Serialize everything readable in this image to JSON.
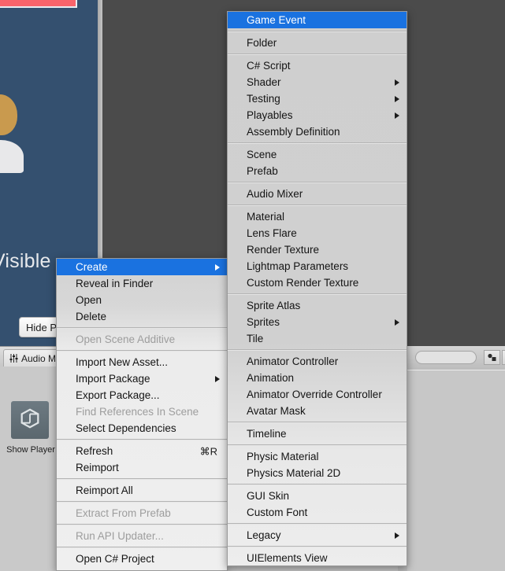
{
  "editor": {
    "game_view": {
      "overlay_text": "Visible",
      "hide_button_label": "Hide P"
    },
    "tab_label": "Audio Mix",
    "tab_icon": "audio-mixer-icon",
    "asset": {
      "icon": "unity-logo-icon",
      "label": "Show Player"
    },
    "search_placeholder": "",
    "toolbar_icons": [
      "asset-filter-icon",
      "favorites-icon"
    ]
  },
  "asset_menu": {
    "name": "assets-context-menu",
    "groups": [
      {
        "items": [
          {
            "label": "Create",
            "submenu": true,
            "selected": true,
            "disabled": false
          },
          {
            "label": "Reveal in Finder",
            "submenu": false,
            "selected": false,
            "disabled": false
          },
          {
            "label": "Open",
            "submenu": false,
            "selected": false,
            "disabled": false
          },
          {
            "label": "Delete",
            "submenu": false,
            "selected": false,
            "disabled": false
          }
        ]
      },
      {
        "items": [
          {
            "label": "Open Scene Additive",
            "submenu": false,
            "selected": false,
            "disabled": true
          }
        ]
      },
      {
        "items": [
          {
            "label": "Import New Asset...",
            "submenu": false,
            "selected": false,
            "disabled": false
          },
          {
            "label": "Import Package",
            "submenu": true,
            "selected": false,
            "disabled": false
          },
          {
            "label": "Export Package...",
            "submenu": false,
            "selected": false,
            "disabled": false
          },
          {
            "label": "Find References In Scene",
            "submenu": false,
            "selected": false,
            "disabled": true
          },
          {
            "label": "Select Dependencies",
            "submenu": false,
            "selected": false,
            "disabled": false
          }
        ]
      },
      {
        "items": [
          {
            "label": "Refresh",
            "shortcut": "⌘R",
            "submenu": false,
            "selected": false,
            "disabled": false
          },
          {
            "label": "Reimport",
            "submenu": false,
            "selected": false,
            "disabled": false
          }
        ]
      },
      {
        "items": [
          {
            "label": "Reimport All",
            "submenu": false,
            "selected": false,
            "disabled": false
          }
        ]
      },
      {
        "items": [
          {
            "label": "Extract From Prefab",
            "submenu": false,
            "selected": false,
            "disabled": true
          }
        ]
      },
      {
        "items": [
          {
            "label": "Run API Updater...",
            "submenu": false,
            "selected": false,
            "disabled": true
          }
        ]
      },
      {
        "items": [
          {
            "label": "Open C# Project",
            "submenu": false,
            "selected": false,
            "disabled": false
          }
        ]
      }
    ]
  },
  "create_menu": {
    "name": "create-submenu",
    "groups": [
      {
        "items": [
          {
            "label": "Game Event",
            "submenu": false,
            "selected": true,
            "disabled": false
          }
        ]
      },
      {
        "items": [
          {
            "label": "Folder",
            "submenu": false,
            "selected": false,
            "disabled": false
          }
        ]
      },
      {
        "items": [
          {
            "label": "C# Script",
            "submenu": false,
            "selected": false,
            "disabled": false
          },
          {
            "label": "Shader",
            "submenu": true,
            "selected": false,
            "disabled": false
          },
          {
            "label": "Testing",
            "submenu": true,
            "selected": false,
            "disabled": false
          },
          {
            "label": "Playables",
            "submenu": true,
            "selected": false,
            "disabled": false
          },
          {
            "label": "Assembly Definition",
            "submenu": false,
            "selected": false,
            "disabled": false
          }
        ]
      },
      {
        "items": [
          {
            "label": "Scene",
            "submenu": false,
            "selected": false,
            "disabled": false
          },
          {
            "label": "Prefab",
            "submenu": false,
            "selected": false,
            "disabled": false
          }
        ]
      },
      {
        "items": [
          {
            "label": "Audio Mixer",
            "submenu": false,
            "selected": false,
            "disabled": false
          }
        ]
      },
      {
        "items": [
          {
            "label": "Material",
            "submenu": false,
            "selected": false,
            "disabled": false
          },
          {
            "label": "Lens Flare",
            "submenu": false,
            "selected": false,
            "disabled": false
          },
          {
            "label": "Render Texture",
            "submenu": false,
            "selected": false,
            "disabled": false
          },
          {
            "label": "Lightmap Parameters",
            "submenu": false,
            "selected": false,
            "disabled": false
          },
          {
            "label": "Custom Render Texture",
            "submenu": false,
            "selected": false,
            "disabled": false
          }
        ]
      },
      {
        "items": [
          {
            "label": "Sprite Atlas",
            "submenu": false,
            "selected": false,
            "disabled": false
          },
          {
            "label": "Sprites",
            "submenu": true,
            "selected": false,
            "disabled": false
          },
          {
            "label": "Tile",
            "submenu": false,
            "selected": false,
            "disabled": false
          }
        ]
      },
      {
        "items": [
          {
            "label": "Animator Controller",
            "submenu": false,
            "selected": false,
            "disabled": false
          },
          {
            "label": "Animation",
            "submenu": false,
            "selected": false,
            "disabled": false
          },
          {
            "label": "Animator Override Controller",
            "submenu": false,
            "selected": false,
            "disabled": false
          },
          {
            "label": "Avatar Mask",
            "submenu": false,
            "selected": false,
            "disabled": false
          }
        ]
      },
      {
        "items": [
          {
            "label": "Timeline",
            "submenu": false,
            "selected": false,
            "disabled": false
          }
        ]
      },
      {
        "items": [
          {
            "label": "Physic Material",
            "submenu": false,
            "selected": false,
            "disabled": false
          },
          {
            "label": "Physics Material 2D",
            "submenu": false,
            "selected": false,
            "disabled": false
          }
        ]
      },
      {
        "items": [
          {
            "label": "GUI Skin",
            "submenu": false,
            "selected": false,
            "disabled": false
          },
          {
            "label": "Custom Font",
            "submenu": false,
            "selected": false,
            "disabled": false
          }
        ]
      },
      {
        "items": [
          {
            "label": "Legacy",
            "submenu": true,
            "selected": false,
            "disabled": false
          }
        ]
      },
      {
        "items": [
          {
            "label": "UIElements View",
            "submenu": false,
            "selected": false,
            "disabled": false
          }
        ]
      }
    ]
  }
}
